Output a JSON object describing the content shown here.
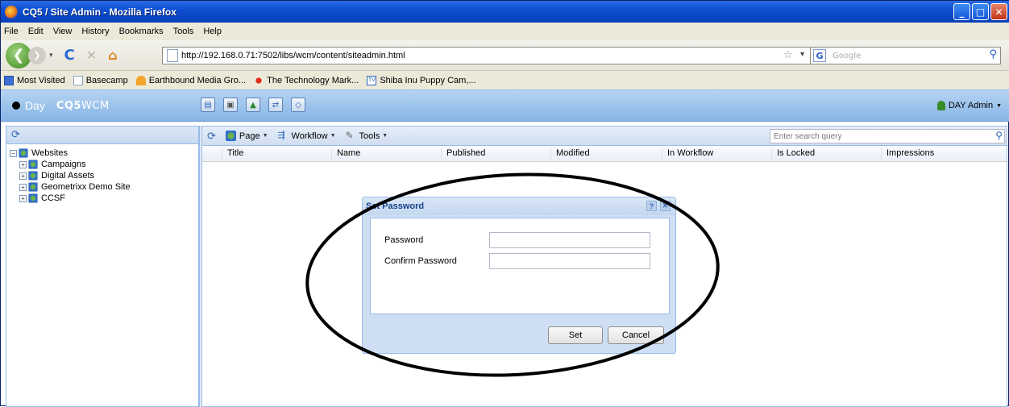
{
  "window": {
    "title": "CQ5 / Site Admin - Mozilla Firefox"
  },
  "menu": [
    "File",
    "Edit",
    "View",
    "History",
    "Bookmarks",
    "Tools",
    "Help"
  ],
  "nav": {
    "url": "http://192.168.0.71:7502/libs/wcm/content/siteadmin.html",
    "search_engine": "Google"
  },
  "bookmarks": [
    "Most Visited",
    "Basecamp",
    "Earthbound Media Gro...",
    "The Technology Mark...",
    "Shiba Inu Puppy Cam,..."
  ],
  "cq": {
    "brand_day": "Day",
    "brand_product_bold": "CQ5",
    "brand_product": "WCM",
    "user": "DAY Admin"
  },
  "tree": {
    "root": "Websites",
    "children": [
      "Campaigns",
      "Digital Assets",
      "Geometrixx Demo Site",
      "CCSF"
    ]
  },
  "toolbar": {
    "page": "Page",
    "workflow": "Workflow",
    "tools": "Tools",
    "search_placeholder": "Enter search query"
  },
  "grid": {
    "columns": [
      "Title",
      "Name",
      "Published",
      "Modified",
      "In Workflow",
      "Is Locked",
      "Impressions"
    ]
  },
  "dialog": {
    "title": "Set Password",
    "password_label": "Password",
    "confirm_label": "Confirm Password",
    "set_button": "Set",
    "cancel_button": "Cancel"
  },
  "colors": {
    "titlebar": "#0c4dd1",
    "cq_header": "#87b5e6",
    "panel_border": "#99bbe8"
  }
}
